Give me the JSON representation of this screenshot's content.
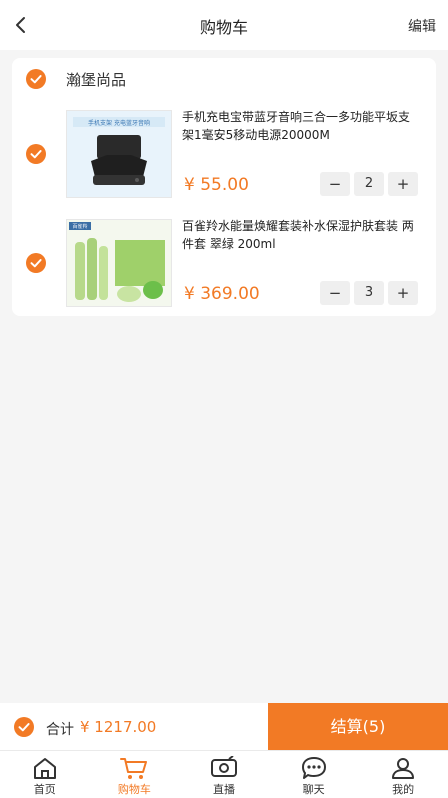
{
  "header": {
    "title": "购物车",
    "edit_label": "编辑",
    "back_icon": "chevron-left-icon"
  },
  "shop": {
    "name": "瀚堡尚品"
  },
  "items": [
    {
      "name": "手机充电宝带蓝牙音响三合一多功能平坂支架1毫安5移动电源20000M",
      "price": "¥ 55.00",
      "quantity": "2",
      "minus": "−",
      "plus": "+",
      "thumb_caption": "手机支架 充电蓝牙音响"
    },
    {
      "name": "百雀羚水能量焕耀套装补水保湿护肤套装 两件套 翠绿 200ml",
      "price": "¥ 369.00",
      "quantity": "3",
      "minus": "−",
      "plus": "+",
      "thumb_caption": "百雀羚"
    }
  ],
  "checkout": {
    "total_label": "合计",
    "total_amount": "¥  1217.00",
    "button_label": "结算(5)"
  },
  "tabbar": [
    {
      "label": "首页",
      "icon": "home-icon"
    },
    {
      "label": "购物车",
      "icon": "cart-icon",
      "active": true
    },
    {
      "label": "直播",
      "icon": "live-icon"
    },
    {
      "label": "聊天",
      "icon": "chat-icon"
    },
    {
      "label": "我的",
      "icon": "profile-icon"
    }
  ],
  "colors": {
    "accent": "#f27a25",
    "background": "#f5f5f5"
  }
}
